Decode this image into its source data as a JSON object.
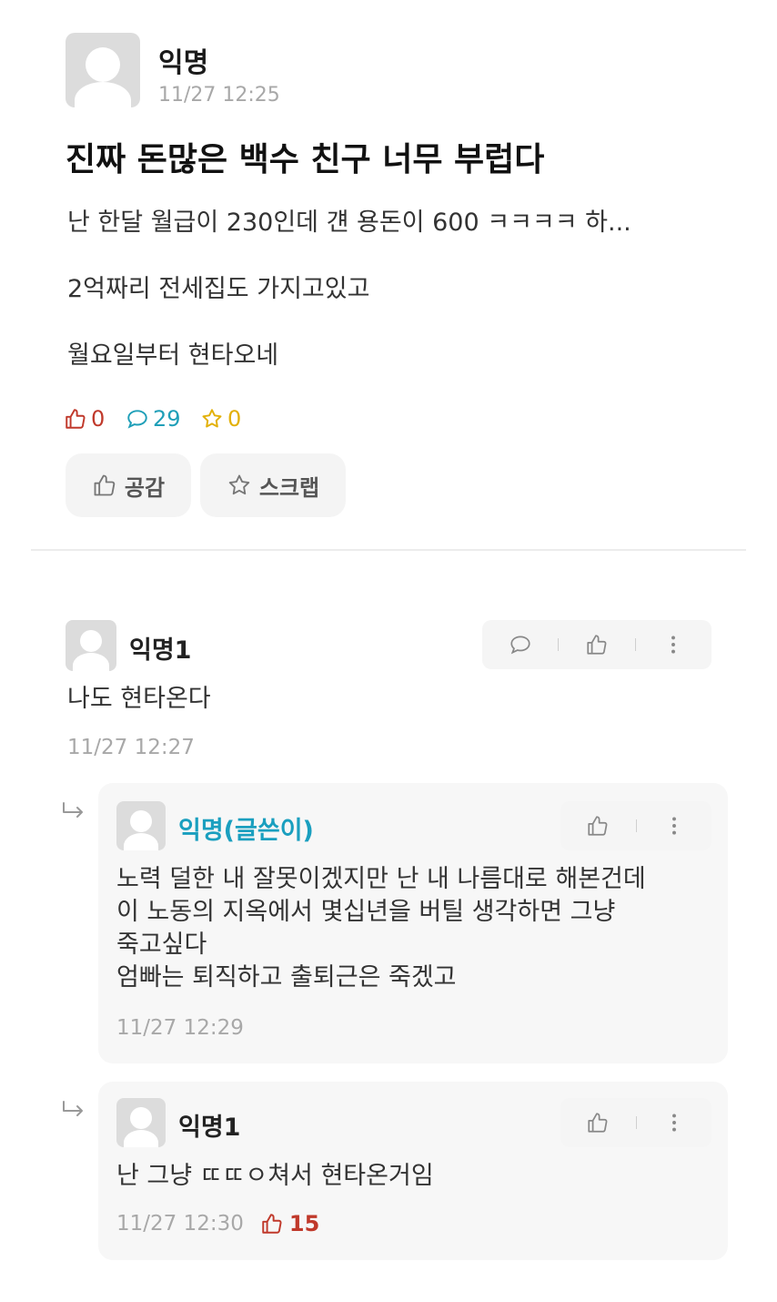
{
  "post": {
    "author": "익명",
    "time": "11/27 12:25",
    "title": "진짜 돈많은 백수 친구 너무 부럽다",
    "body": [
      "난 한달 월급이 230인데 걘 용돈이 600 ㅋㅋㅋㅋ 하...",
      "2억짜리 전세집도 가지고있고",
      "월요일부터 현타오네"
    ],
    "stats": {
      "likes": "0",
      "comments": "29",
      "scraps": "0"
    },
    "buttons": {
      "like": "공감",
      "scrap": "스크랩"
    }
  },
  "comments": [
    {
      "author": "익명1",
      "text": "나도 현타온다",
      "time": "11/27 12:27"
    }
  ],
  "replies": [
    {
      "author": "익명(글쓴이)",
      "lines": [
        "노력 덜한 내 잘못이겠지만 난 내 나름대로 해본건데",
        "이 노동의 지옥에서 몇십년을 버틸 생각하면 그냥",
        "죽고싶다",
        "엄빠는 퇴직하고 출퇴근은 죽겠고"
      ],
      "time": "11/27 12:29"
    },
    {
      "author": "익명1",
      "text": "난 그냥 ㄸㄸㅇ쳐서 현타온거임",
      "time": "11/27 12:30",
      "likes": "15"
    }
  ],
  "icons": {
    "like": "thumbs-up-icon",
    "comment": "speech-bubble-icon",
    "scrap": "star-icon",
    "more": "more-vertical-icon",
    "reply": "reply-arrow-icon"
  },
  "colors": {
    "like": "#c0392b",
    "comment": "#1f9fb8",
    "scrap": "#e2b007",
    "writer": "#1a9fbf"
  }
}
